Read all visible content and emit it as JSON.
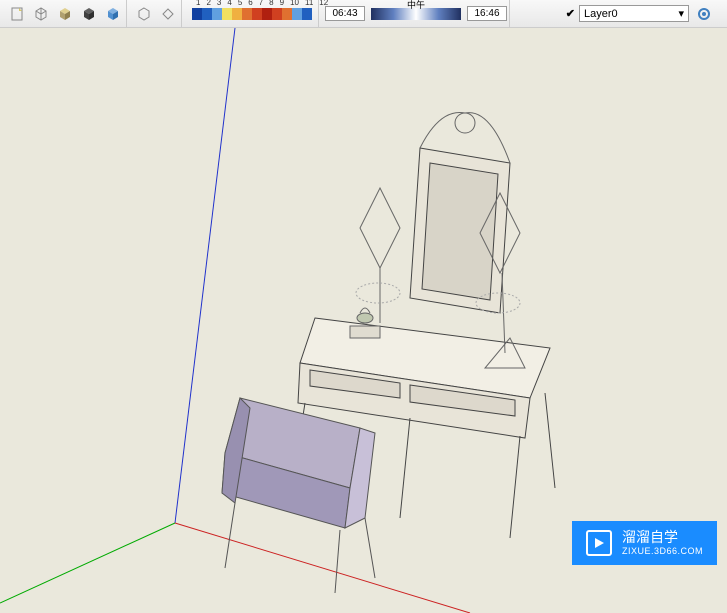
{
  "toolbar": {
    "icons": [
      {
        "name": "page-icon",
        "color": "#d9c96b"
      },
      {
        "name": "cube-outline-icon",
        "color": "#808080"
      },
      {
        "name": "cube-shaded-icon",
        "color": "#b0a070"
      },
      {
        "name": "cube-dark-icon",
        "color": "#404040"
      },
      {
        "name": "cube-blue-icon",
        "color": "#5090d0"
      }
    ],
    "icons2": [
      {
        "name": "hex-icon",
        "color": "#808080"
      },
      {
        "name": "diamond-icon",
        "color": "#808080"
      }
    ],
    "gradient_ticks": [
      "1",
      "2",
      "3",
      "4",
      "5",
      "6",
      "7",
      "8",
      "9",
      "10",
      "11",
      "12"
    ],
    "time_start": "06:43",
    "time_mid": "中午",
    "time_end": "16:46"
  },
  "layer": {
    "current": "Layer0"
  },
  "watermark": {
    "title": "溜溜自学",
    "sub": "ZIXUE.3D66.COM"
  }
}
